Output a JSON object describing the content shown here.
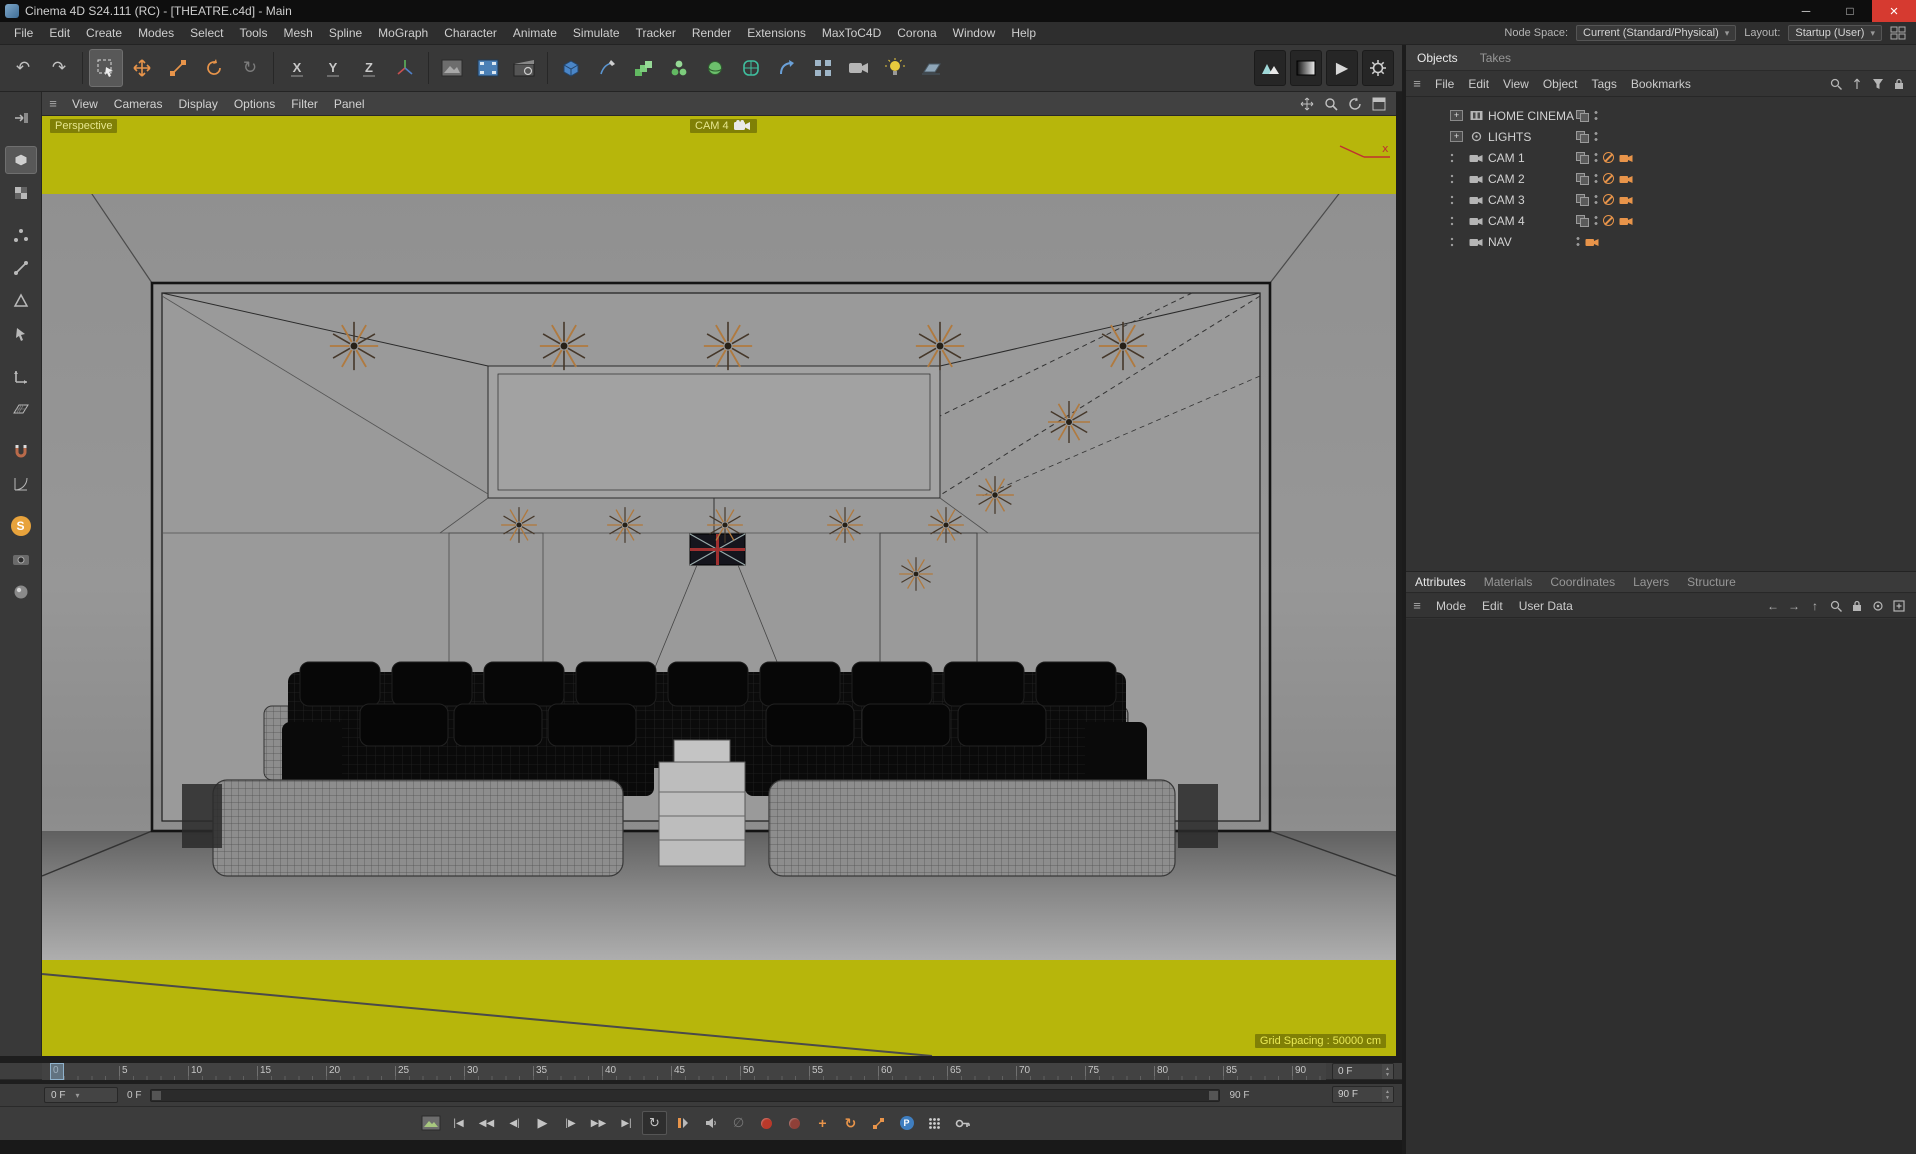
{
  "window": {
    "title": "Cinema 4D S24.111 (RC) - [THEATRE.c4d] - Main"
  },
  "icons": {
    "expand": "+",
    "undo": "↶",
    "redo": "↷",
    "dropdown": "▾",
    "hamburger": "≡",
    "minimize": "─",
    "maximize": "□",
    "close": "×",
    "loop": "↻",
    "goto_start": "|◀",
    "prev_key": "◀◀",
    "prev_frame": "◀|",
    "play": "▶",
    "next_frame": "|▶",
    "next_key": "▶▶",
    "goto_end": "▶|",
    "null_sign": "∅",
    "spin_up": "▲",
    "spin_down": "▼",
    "arrow_left": "←",
    "arrow_right": "→",
    "arrow_up": "↑",
    "plus": "+",
    "param": "P",
    "s_logo": "S",
    "last_tool": "↻"
  },
  "menu_bar": {
    "items": [
      "File",
      "Edit",
      "Create",
      "Modes",
      "Select",
      "Tools",
      "Mesh",
      "Spline",
      "MoGraph",
      "Character",
      "Animate",
      "Simulate",
      "Tracker",
      "Render",
      "Extensions",
      "MaxToC4D",
      "Corona",
      "Window",
      "Help"
    ],
    "node_space_label": "Node Space:",
    "node_space_value": "Current (Standard/Physical)",
    "layout_label": "Layout:",
    "layout_value": "Startup (User)"
  },
  "toolbar": {
    "axis_locks": [
      "X",
      "Y",
      "Z"
    ]
  },
  "viewport": {
    "menu": [
      "View",
      "Cameras",
      "Display",
      "Options",
      "Filter",
      "Panel"
    ],
    "perspective_label": "Perspective",
    "camera_label": "CAM 4",
    "grid_spacing": "Grid Spacing : 50000 cm",
    "axis_label": "x"
  },
  "objects_panel": {
    "tabs": [
      "Objects",
      "Takes"
    ],
    "menu": [
      "File",
      "Edit",
      "View",
      "Object",
      "Tags",
      "Bookmarks"
    ],
    "rows": [
      {
        "name": "HOME CINEMA"
      },
      {
        "name": "LIGHTS"
      },
      {
        "name": "CAM 1"
      },
      {
        "name": "CAM 2"
      },
      {
        "name": "CAM 3"
      },
      {
        "name": "CAM 4"
      },
      {
        "name": "NAV"
      }
    ]
  },
  "attributes_panel": {
    "tabs": [
      "Attributes",
      "Materials",
      "Coordinates",
      "Layers",
      "Structure"
    ],
    "menu": [
      "Mode",
      "Edit",
      "User Data"
    ]
  },
  "timeline": {
    "ticks": [
      "0",
      "5",
      "10",
      "15",
      "20",
      "25",
      "30",
      "35",
      "40",
      "45",
      "50",
      "55",
      "60",
      "65",
      "70",
      "75",
      "80",
      "85",
      "90"
    ],
    "current_frame": "0 F",
    "marker_dropdown": "0 F",
    "range_start": "0 F",
    "range_end": "90 F",
    "range_end_field": "90 F"
  }
}
